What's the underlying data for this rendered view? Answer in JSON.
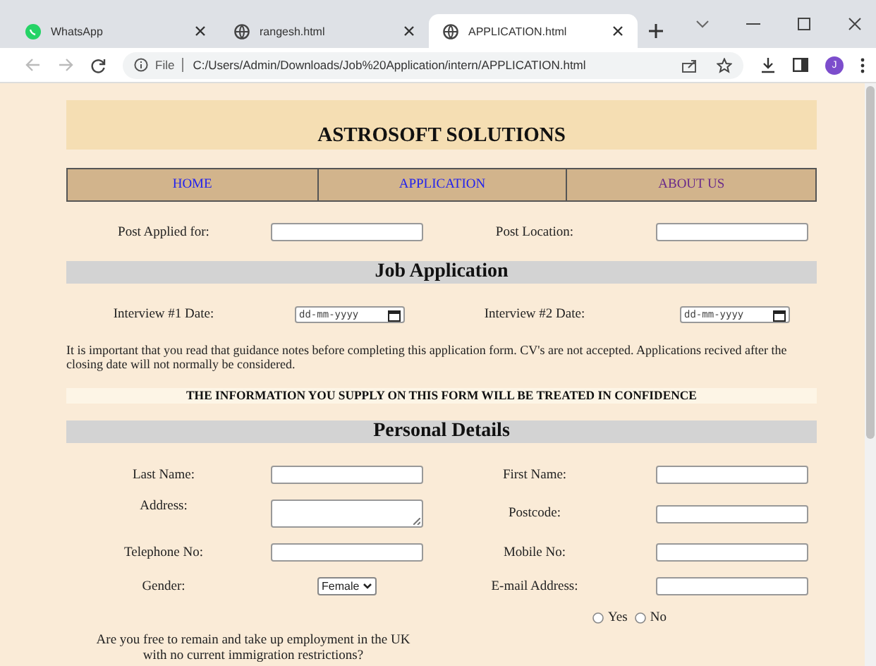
{
  "browser": {
    "tabs": [
      {
        "title": "WhatsApp",
        "kind": "chat",
        "selected": false
      },
      {
        "title": "rangesh.html",
        "kind": "web",
        "selected": false
      },
      {
        "title": "APPLICATION.html",
        "kind": "web",
        "selected": true
      }
    ],
    "address": {
      "scheme": "File",
      "url": "C:/Users/Admin/Downloads/Job%20Application/intern/APPLICATION.html"
    },
    "profile": "J"
  },
  "page": {
    "title": "ASTROSOFT SOLUTIONS",
    "nav": [
      {
        "label": "HOME",
        "visited": false
      },
      {
        "label": "APPLICATION",
        "visited": false
      },
      {
        "label": "ABOUT US",
        "visited": true
      }
    ],
    "post_fields": [
      {
        "label": "Post Applied for:",
        "kind": "text"
      },
      {
        "label": "Post Location:",
        "kind": "text"
      }
    ],
    "job_heading": "Job Application",
    "interview_fields": [
      {
        "label": "Interview #1 Date:",
        "kind": "date",
        "placeholder": "dd-mm-yyyy"
      },
      {
        "label": "Interview #2 Date:",
        "kind": "date",
        "placeholder": "dd-mm-yyyy"
      }
    ],
    "notice": "It is important that you read that guidance notes before completing this application form. CV's are not accepted. Applications recived after the closing date will not normally be considered.",
    "confidence": "THE INFORMATION YOU SUPPLY ON THIS FORM WILL BE TREATED IN CONFIDENCE",
    "personal_heading": "Personal Details",
    "personal_fields": [
      {
        "label": "Last Name:",
        "kind": "text"
      },
      {
        "label": "First Name:",
        "kind": "text"
      },
      {
        "label": "Address:",
        "kind": "textarea"
      },
      {
        "label": "Postcode:",
        "kind": "text"
      },
      {
        "label": "Telephone No:",
        "kind": "text"
      },
      {
        "label": "Mobile No:",
        "kind": "text"
      },
      {
        "label": "Gender:",
        "kind": "select",
        "value": "Female"
      },
      {
        "label": "E-mail Address:",
        "kind": "text"
      }
    ],
    "question": {
      "text": "Are you free to remain and take up employment in the UK with no current immigration restrictions?",
      "options": [
        {
          "label": "Yes",
          "selected": false
        },
        {
          "label": "No",
          "selected": false
        }
      ]
    }
  }
}
